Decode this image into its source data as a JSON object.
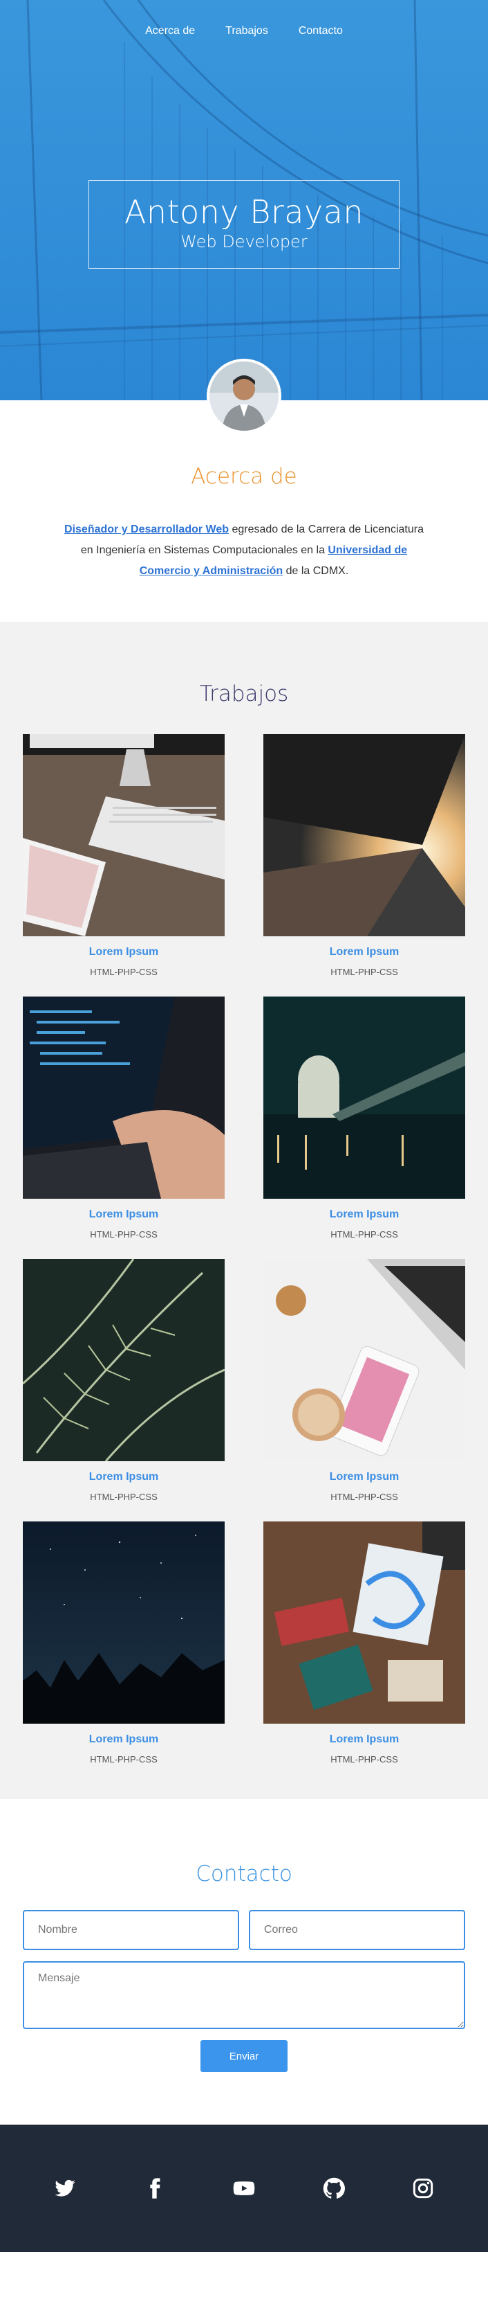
{
  "nav": {
    "items": [
      {
        "label": "Acerca de"
      },
      {
        "label": "Trabajos"
      },
      {
        "label": "Contacto"
      }
    ]
  },
  "hero": {
    "name": "Antony Brayan",
    "role": "Web Developer"
  },
  "about": {
    "title": "Acerca de",
    "link1": "Diseñador y Desarrollador Web",
    "text1": " egresado de la Carrera de Licenciatura en Ingeniería en Sistemas Computacionales en la ",
    "link2": "Universidad de Comercio y Administración",
    "text2": " de la CDMX."
  },
  "works": {
    "title": "Trabajos",
    "items": [
      {
        "title": "Lorem Ipsum",
        "subtitle": "HTML-PHP-CSS"
      },
      {
        "title": "Lorem Ipsum",
        "subtitle": "HTML-PHP-CSS"
      },
      {
        "title": "Lorem Ipsum",
        "subtitle": "HTML-PHP-CSS"
      },
      {
        "title": "Lorem Ipsum",
        "subtitle": "HTML-PHP-CSS"
      },
      {
        "title": "Lorem Ipsum",
        "subtitle": "HTML-PHP-CSS"
      },
      {
        "title": "Lorem Ipsum",
        "subtitle": "HTML-PHP-CSS"
      },
      {
        "title": "Lorem Ipsum",
        "subtitle": "HTML-PHP-CSS"
      },
      {
        "title": "Lorem Ipsum",
        "subtitle": "HTML-PHP-CSS"
      }
    ]
  },
  "contact": {
    "title": "Contacto",
    "name_placeholder": "Nombre",
    "email_placeholder": "Correo",
    "message_placeholder": "Mensaje",
    "send_label": "Enviar"
  },
  "footer": {
    "social": [
      "twitter-icon",
      "facebook-icon",
      "youtube-icon",
      "github-icon",
      "instagram-icon"
    ]
  },
  "colors": {
    "hero_blue": "#2f8fd8",
    "about_title": "#e8912c",
    "works_title": "#3c3a6e",
    "link_blue": "#3b8ee4",
    "footer_bg": "#212a38"
  }
}
